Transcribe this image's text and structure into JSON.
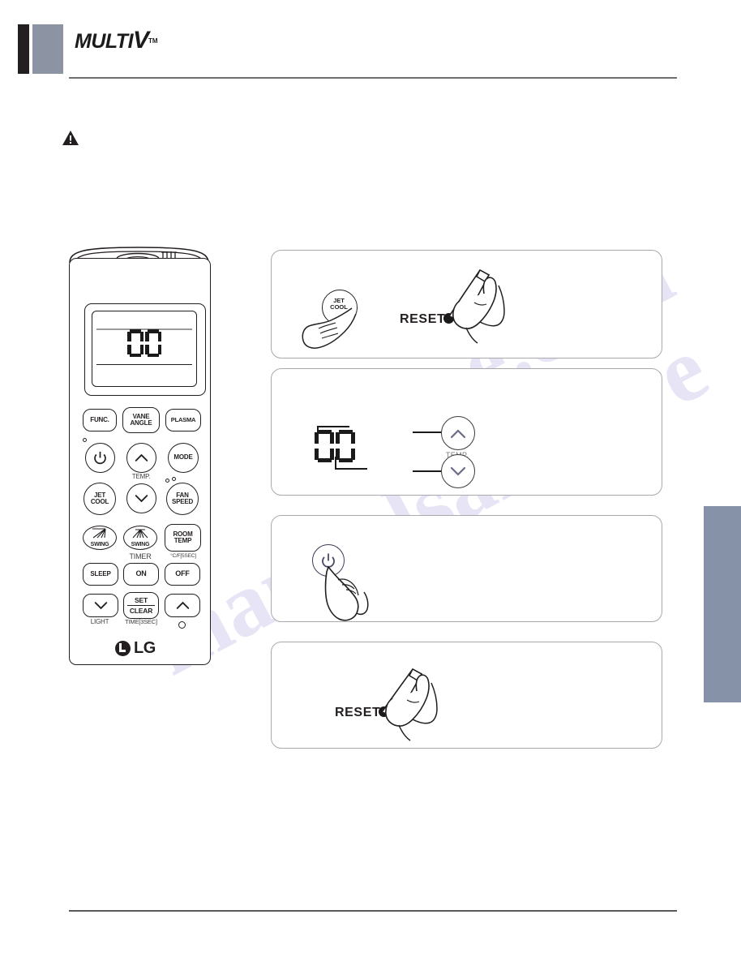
{
  "header": {
    "logo_text": "MULTI",
    "logo_v": "V",
    "logo_tm": "TM"
  },
  "warning": {
    "icon": "warning-triangle-icon"
  },
  "watermark": {
    "line1": "manualsarchive",
    "line2": "e.com"
  },
  "remote": {
    "lcd": {
      "value": "00",
      "digits": [
        "0",
        "0"
      ]
    },
    "buttons": [
      {
        "id": "func",
        "label": "FUNC."
      },
      {
        "id": "vane-angle",
        "label": "VANE\nANGLE"
      },
      {
        "id": "plasma",
        "label": "PLASMA"
      },
      {
        "id": "power",
        "label": "power-icon"
      },
      {
        "id": "temp-up",
        "label": "chevron-up-icon"
      },
      {
        "id": "mode",
        "label": "MODE"
      },
      {
        "id": "jet-cool",
        "label": "JET\nCOOL"
      },
      {
        "id": "temp-down",
        "label": "chevron-down-icon"
      },
      {
        "id": "fan-speed",
        "label": "FAN\nSPEED"
      },
      {
        "id": "swing-vert",
        "label": "SWING"
      },
      {
        "id": "swing-horz",
        "label": "SWING"
      },
      {
        "id": "room-temp",
        "label": "ROOM\nTEMP"
      },
      {
        "id": "sleep",
        "label": "SLEEP"
      },
      {
        "id": "timer-on",
        "label": "ON"
      },
      {
        "id": "timer-off",
        "label": "OFF"
      },
      {
        "id": "light-down",
        "label": "chevron-down-icon"
      },
      {
        "id": "set-clear",
        "label_top": "SET",
        "label_bottom": "CLEAR"
      },
      {
        "id": "up",
        "label": "chevron-up-icon"
      }
    ],
    "sub_labels": {
      "temp": "TEMP.",
      "timer": "TIMER",
      "celsius_fahrenheit": "°C/F[5SEC]",
      "light": "LIGHT",
      "time_3sec": "TIME[3SEC]"
    },
    "brand": "LG"
  },
  "panels": [
    {
      "id": "panel-jetcool-reset",
      "jet_cool_label": "JET\nCOOL",
      "reset_label": "RESET"
    },
    {
      "id": "panel-temp-adjust",
      "display_value": "00",
      "temp_label": "TEMP."
    },
    {
      "id": "panel-power",
      "power_icon": "power-icon"
    },
    {
      "id": "panel-reset",
      "reset_label": "RESET"
    }
  ],
  "colors": {
    "brand_dark": "#231f20",
    "brand_gray": "#8c93a3",
    "tab_blue_gray": "#8592a8",
    "rule_gray": "#6d6e71",
    "panel_border": "#a7a9ac"
  }
}
